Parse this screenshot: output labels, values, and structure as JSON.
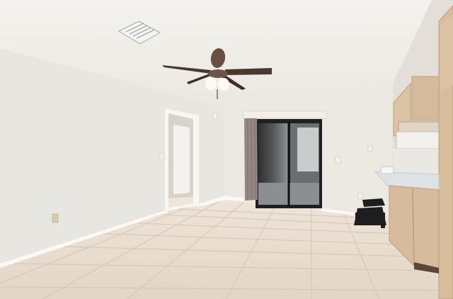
{
  "scene": {
    "kind": "photo",
    "description_visible_text": "",
    "colors": {
      "ceiling": "#f1efea",
      "wall_left": "#e9e7e3",
      "wall_back": "#ece9e4",
      "wall_right": "#e6e2dc",
      "floor": "#e8dccf",
      "floor_grout": "#d6c8b8",
      "baseboard": "#f8f7f5",
      "cabinet": "#d9bfa0",
      "cabinet_shadow": "#b89d80",
      "countertop": "#dde3e6",
      "curtain": "#9a8d86",
      "glass_dark": "#3c3d3f",
      "glass_light": "#9ea3a6",
      "fan_blade": "#4a3730",
      "fan_light": "#fbf6e8",
      "vent": "#c9c9c9",
      "stool": "#1e1e20"
    }
  }
}
